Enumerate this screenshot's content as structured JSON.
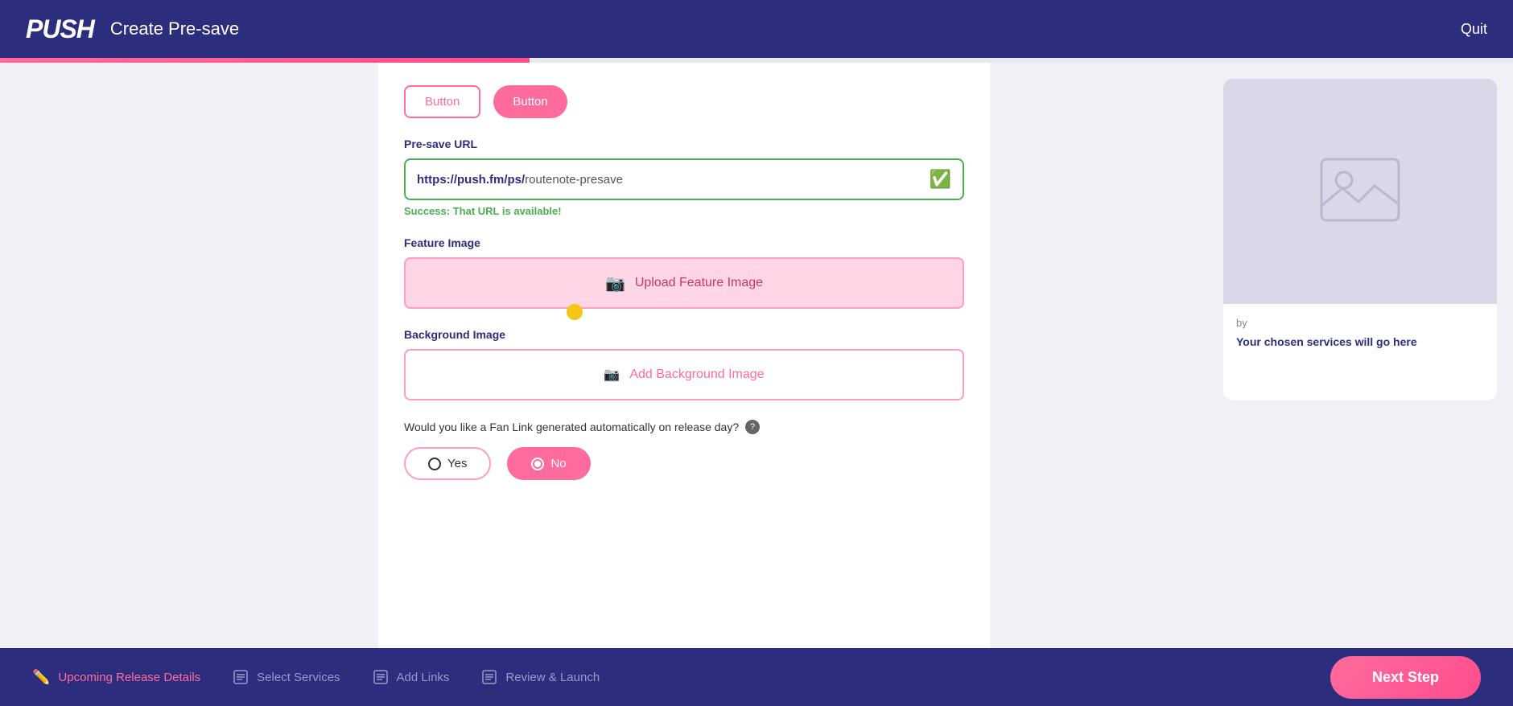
{
  "header": {
    "logo": "PUSH",
    "title": "Create Pre-save",
    "quit_label": "Quit"
  },
  "url_field": {
    "label": "Pre-save URL",
    "prefix": "https://push.fm/ps/",
    "value": "routenote-presave",
    "success_label": "Success:",
    "success_message": " That URL is available!"
  },
  "feature_image": {
    "label": "Feature Image",
    "button_label": "Upload Feature Image"
  },
  "background_image": {
    "label": "Background Image",
    "button_label": "Add Background Image"
  },
  "fan_link": {
    "question": "Would you like a Fan Link generated automatically on release day?",
    "yes_label": "Yes",
    "no_label": "No",
    "selected": "No"
  },
  "preview": {
    "by_text": "by",
    "services_text": "Your chosen services will go here"
  },
  "footer": {
    "steps": [
      {
        "id": "upcoming",
        "label": "Upcoming Release Details",
        "active": true
      },
      {
        "id": "services",
        "label": "Select Services",
        "active": false
      },
      {
        "id": "links",
        "label": "Add Links",
        "active": false
      },
      {
        "id": "review",
        "label": "Review & Launch",
        "active": false
      }
    ],
    "next_label": "Next Step"
  }
}
